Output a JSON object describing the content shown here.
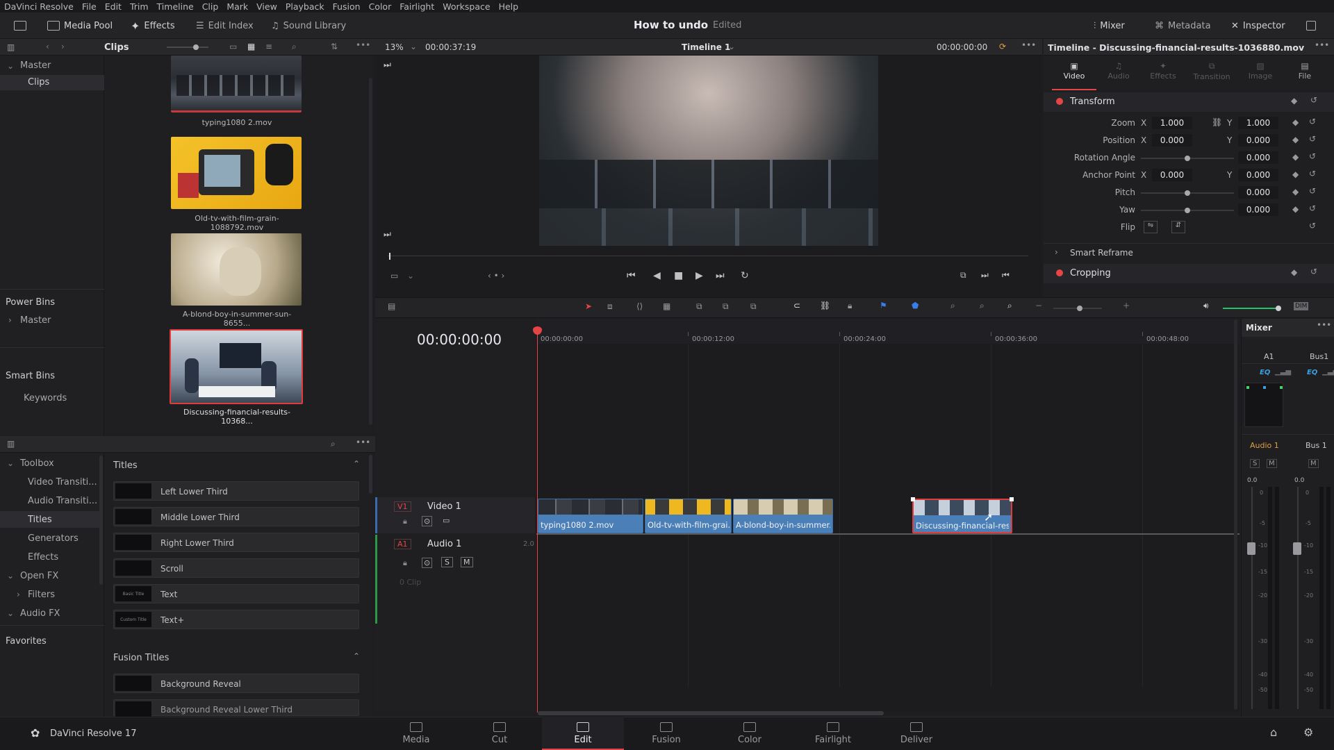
{
  "menu": [
    "DaVinci Resolve",
    "File",
    "Edit",
    "Trim",
    "Timeline",
    "Clip",
    "Mark",
    "View",
    "Playback",
    "Fusion",
    "Color",
    "Fairlight",
    "Workspace",
    "Help"
  ],
  "toolbar": {
    "media_pool": "Media Pool",
    "effects": "Effects",
    "edit_index": "Edit Index",
    "sound_library": "Sound Library",
    "project_title": "How to undo",
    "project_status": "Edited",
    "mixer": "Mixer",
    "metadata": "Metadata",
    "inspector": "Inspector"
  },
  "media_pool": {
    "panel_title": "Clips",
    "zoom": "13%",
    "duration": "00:00:37:19",
    "bins": {
      "master": "Master",
      "clips": "Clips"
    },
    "power_bins": "Power Bins",
    "power_master": "Master",
    "smart_bins": "Smart Bins",
    "keywords": "Keywords",
    "clips": [
      {
        "name": "typing1080 2.mov"
      },
      {
        "name": "Old-tv-with-film-grain-1088792.mov"
      },
      {
        "name": "A-blond-boy-in-summer-sun-8655..."
      },
      {
        "name": "Discussing-financial-results-10368..."
      }
    ]
  },
  "viewer": {
    "timeline_name": "Timeline 1",
    "timecode": "00:00:00:00"
  },
  "inspector": {
    "title": "Timeline - Discussing-financial-results-1036880.mov",
    "tabs": [
      "Video",
      "Audio",
      "Effects",
      "Transition",
      "Image",
      "File"
    ],
    "transform": "Transform",
    "zoom_label": "Zoom",
    "zoom_x": "1.000",
    "zoom_y": "1.000",
    "position_label": "Position",
    "pos_x": "0.000",
    "pos_y": "0.000",
    "rotation_label": "Rotation Angle",
    "rotation": "0.000",
    "anchor_label": "Anchor Point",
    "anchor_x": "0.000",
    "anchor_y": "0.000",
    "pitch_label": "Pitch",
    "pitch": "0.000",
    "yaw_label": "Yaw",
    "yaw": "0.000",
    "flip_label": "Flip",
    "x": "X",
    "y": "Y",
    "smart_reframe": "Smart Reframe",
    "cropping": "Cropping"
  },
  "effects": {
    "toolbox": "Toolbox",
    "video_transitions": "Video Transiti...",
    "audio_transitions": "Audio Transiti...",
    "titles": "Titles",
    "generators": "Generators",
    "effects_item": "Effects",
    "open_fx": "Open FX",
    "filters": "Filters",
    "audio_fx": "Audio FX",
    "favorites": "Favorites",
    "titles_header": "Titles",
    "title_items": [
      "Left Lower Third",
      "Middle Lower Third",
      "Right Lower Third",
      "Scroll",
      "Text",
      "Text+"
    ],
    "title_thumbs": [
      "",
      "",
      "",
      "",
      "Basic Title",
      "Custom Title"
    ],
    "fusion_header": "Fusion Titles",
    "fusion_items": [
      "Background Reveal",
      "Background Reveal Lower Third"
    ]
  },
  "timeline": {
    "timecode": "00:00:00:00",
    "ruler": [
      "00:00:00:00",
      "00:00:12:00",
      "00:00:24:00",
      "00:00:36:00",
      "00:00:48:00"
    ],
    "v1_tag": "V1",
    "video_track": "Video 1",
    "a1_tag": "A1",
    "audio_track": "Audio 1",
    "audio_ch": "2.0",
    "audio_s": "S",
    "audio_m": "M",
    "clip_count": "0 Clip",
    "clips": [
      "typing1080 2.mov",
      "Old-tv-with-film-grai...",
      "A-blond-boy-in-summer...",
      "Discussing-financial-res..."
    ]
  },
  "mixer": {
    "title": "Mixer",
    "a1": "A1",
    "bus1": "Bus1",
    "eq": "EQ",
    "audio1": "Audio 1",
    "bus_1": "Bus 1",
    "s": "S",
    "m": "M",
    "level_a": "0.0",
    "level_b": "0.0",
    "db_scale": [
      "0",
      "-5",
      "-10",
      "-15",
      "-20",
      "-30",
      "-40",
      "-50"
    ]
  },
  "pages": [
    "Media",
    "Cut",
    "Edit",
    "Fusion",
    "Color",
    "Fairlight",
    "Deliver"
  ],
  "app_name": "DaVinci Resolve 17",
  "dim": "DIM",
  "colors": {
    "accent_red": "#e64545",
    "clip_blue": "#4a7fb8",
    "selected_clip_border": "#e03c3c",
    "audio_orange": "#e0a040"
  }
}
